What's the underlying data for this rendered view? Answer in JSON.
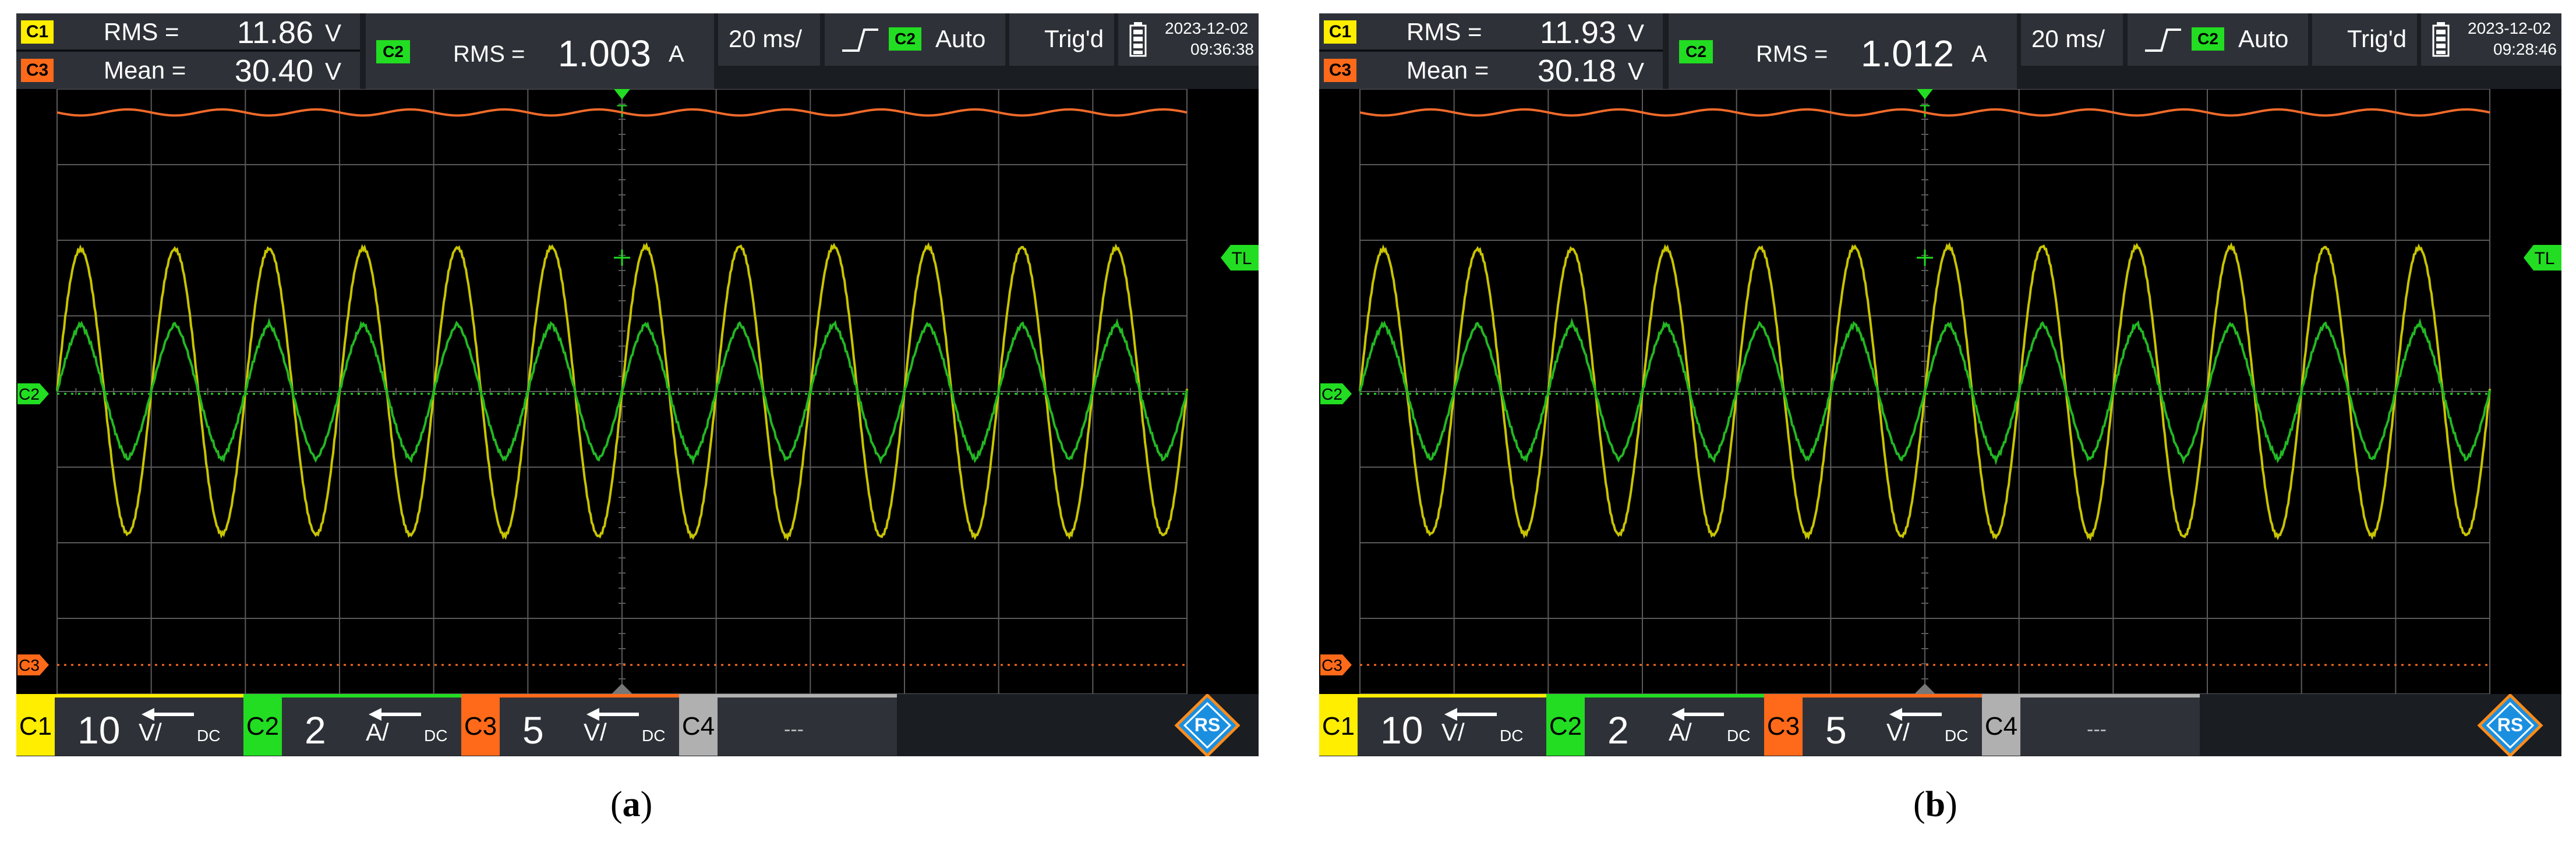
{
  "panels": [
    {
      "id": "a",
      "caption": {
        "open": "(",
        "letter": "a",
        "close": ")"
      },
      "measurements": [
        {
          "channel": "C1",
          "name": "RMS =",
          "value": "11.86",
          "unit": "V"
        },
        {
          "channel": "C3",
          "name": "Mean =",
          "value": "30.40",
          "unit": "V"
        }
      ],
      "current_meas": {
        "channel": "C2",
        "name": "RMS =",
        "value": "1.003",
        "unit": "A"
      },
      "timebase": "20 ms/",
      "trigger": {
        "channel": "C2",
        "mode": "Auto"
      },
      "state": "Trig'd",
      "date": "2023-12-02",
      "time": "09:36:38",
      "markers": {
        "trigger_top": "T",
        "trigger_level": "TL"
      },
      "channels": [
        {
          "label": "C1",
          "scale": "10",
          "unit": "V/",
          "coupling": "DC"
        },
        {
          "label": "C2",
          "scale": "2",
          "unit": "A/",
          "coupling": "DC"
        },
        {
          "label": "C3",
          "scale": "5",
          "unit": "V/",
          "coupling": "DC"
        },
        {
          "label": "C4",
          "scale": "",
          "unit": "",
          "coupling": "",
          "value": "---"
        }
      ],
      "logo_text": "RS"
    },
    {
      "id": "b",
      "caption": {
        "open": "(",
        "letter": "b",
        "close": ")"
      },
      "measurements": [
        {
          "channel": "C1",
          "name": "RMS =",
          "value": "11.93",
          "unit": "V"
        },
        {
          "channel": "C3",
          "name": "Mean =",
          "value": "30.18",
          "unit": "V"
        }
      ],
      "current_meas": {
        "channel": "C2",
        "name": "RMS =",
        "value": "1.012",
        "unit": "A"
      },
      "timebase": "20 ms/",
      "trigger": {
        "channel": "C2",
        "mode": "Auto"
      },
      "state": "Trig'd",
      "date": "2023-12-02",
      "time": "09:28:46",
      "markers": {
        "trigger_top": "T",
        "trigger_level": "TL"
      },
      "channels": [
        {
          "label": "C1",
          "scale": "10",
          "unit": "V/",
          "coupling": "DC"
        },
        {
          "label": "C2",
          "scale": "2",
          "unit": "A/",
          "coupling": "DC"
        },
        {
          "label": "C3",
          "scale": "5",
          "unit": "V/",
          "coupling": "DC"
        },
        {
          "label": "C4",
          "scale": "",
          "unit": "",
          "coupling": "",
          "value": "---"
        }
      ],
      "logo_text": "RS"
    }
  ],
  "colors": {
    "C1": "#ffee00",
    "C2": "#22dd22",
    "C3": "#ff6a1a",
    "C4": "#b0b0b0",
    "trace_C1": "#c8c400",
    "trace_C2": "#22b822",
    "trace_C3": "#f06a2a",
    "grid": "#5a5a5a",
    "logo_blue": "#1a8fe0",
    "logo_orange": "#ff8c1a"
  },
  "waveforms": [
    {
      "panel": "a",
      "C1": {
        "cycles_per_div": 1.0,
        "peak_div": 1.9,
        "phase_deg": 0
      },
      "C2": {
        "peak_div": 0.9,
        "phase_deg": 0
      },
      "C3": {
        "level_div": 4.5,
        "ripple_div": 0.04
      }
    },
    {
      "panel": "b",
      "C1": {
        "cycles_per_div": 1.0,
        "peak_div": 1.9,
        "phase_deg": 0
      },
      "C2": {
        "peak_div": 0.9,
        "phase_deg": 0
      },
      "C3": {
        "level_div": 4.5,
        "ripple_div": 0.04
      }
    }
  ]
}
